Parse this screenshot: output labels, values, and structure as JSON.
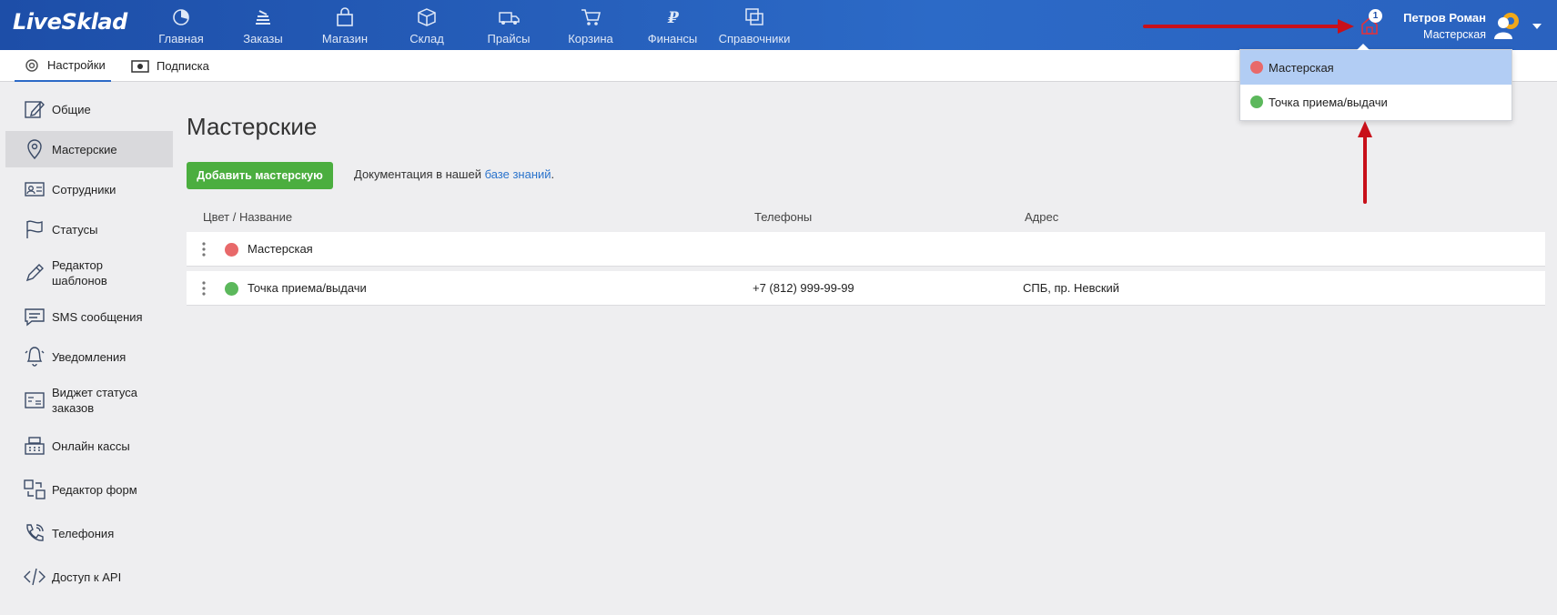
{
  "app": {
    "logo": "LiveSklad"
  },
  "nav": [
    {
      "label": "Главная",
      "icon": "pie-chart-icon"
    },
    {
      "label": "Заказы",
      "icon": "orders-icon"
    },
    {
      "label": "Магазин",
      "icon": "shop-bag-icon"
    },
    {
      "label": "Склад",
      "icon": "box-icon"
    },
    {
      "label": "Прайсы",
      "icon": "truck-icon"
    },
    {
      "label": "Корзина",
      "icon": "cart-icon"
    },
    {
      "label": "Финансы",
      "icon": "ruble-icon"
    },
    {
      "label": "Справочники",
      "icon": "copy-icon"
    }
  ],
  "header": {
    "notification_count": "1",
    "user_name": "Петров Роман",
    "user_location": "Мастерская"
  },
  "subnav": {
    "settings_label": "Настройки",
    "subscription_label": "Подписка"
  },
  "sidebar": {
    "items": [
      {
        "label": "Общие",
        "icon": "edit-icon"
      },
      {
        "label": "Мастерские",
        "icon": "location-pin-icon"
      },
      {
        "label": "Сотрудники",
        "icon": "id-card-icon"
      },
      {
        "label": "Статусы",
        "icon": "flag-icon"
      },
      {
        "label": "Редактор шаблонов",
        "icon": "pen-icon"
      },
      {
        "label": "SMS сообщения",
        "icon": "message-icon"
      },
      {
        "label": "Уведомления",
        "icon": "bell-icon"
      },
      {
        "label": "Виджет статуса заказов",
        "icon": "widget-icon"
      },
      {
        "label": "Онлайн кассы",
        "icon": "cash-register-icon"
      },
      {
        "label": "Редактор форм",
        "icon": "forms-icon"
      },
      {
        "label": "Телефония",
        "icon": "phone-icon"
      },
      {
        "label": "Доступ к API",
        "icon": "code-icon"
      }
    ]
  },
  "main": {
    "title": "Мастерские",
    "add_button": "Добавить мастерскую",
    "doc_prefix": "Документация в нашей ",
    "doc_link": "базе знаний",
    "doc_suffix": ".",
    "columns": {
      "name": "Цвет / Название",
      "phones": "Телефоны",
      "address": "Адрес"
    },
    "rows": [
      {
        "name": "Мастерская",
        "phone": "",
        "address": "",
        "color": "#e8696a"
      },
      {
        "name": "Точка приема/выдачи",
        "phone": "+7 (812) 999-99-99",
        "address": "СПБ, пр. Невский",
        "color": "#5cb85c"
      }
    ]
  },
  "dropdown": {
    "items": [
      {
        "label": "Мастерская",
        "color": "#e8696a"
      },
      {
        "label": "Точка приема/выдачи",
        "color": "#5cb85c"
      }
    ]
  },
  "colors": {
    "header": "#2c6ac7",
    "accent_green": "#4bae3f",
    "link": "#2a73cc",
    "annotation_arrow": "#c8101a"
  }
}
